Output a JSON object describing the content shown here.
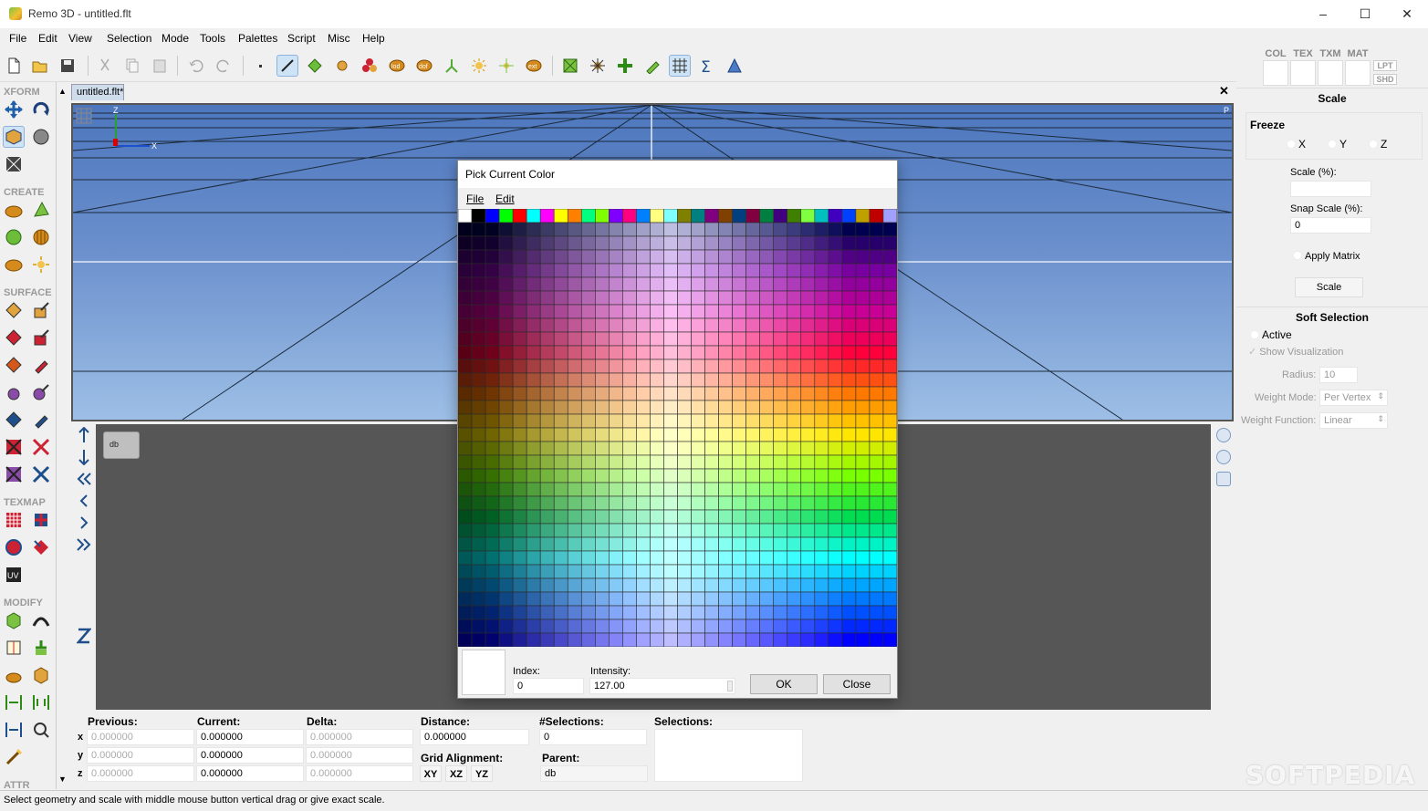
{
  "window": {
    "title": "Remo 3D - untitled.flt",
    "minimize": "–",
    "maximize": "☐",
    "close": "✕"
  },
  "menubar": [
    "File",
    "Edit",
    "View",
    "Selection",
    "Mode",
    "Tools",
    "Palettes",
    "Script",
    "Misc",
    "Help"
  ],
  "toolbar_icons": [
    "new-file-icon",
    "open-folder-icon",
    "save-icon",
    "cut-icon",
    "copy-icon",
    "paste-icon",
    "undo-icon",
    "redo-icon",
    "vertex-mode-icon",
    "edge-mode-icon",
    "face-mode-icon",
    "object-mode-icon",
    "group-mode-icon",
    "lod-icon",
    "dof-icon",
    "switch-icon",
    "light-icon",
    "light-point-icon",
    "external-ref-icon",
    "bounding-box-icon",
    "sparkle-icon",
    "move-node-icon",
    "edit-node-icon",
    "grid-icon",
    "sigma-icon",
    "triangle-icon"
  ],
  "left_sections": {
    "xform": "XFORM",
    "create": "CREATE",
    "surface": "SURFACE",
    "texmap": "TEXMAP",
    "modify": "MODIFY",
    "attr": "ATTR"
  },
  "document": {
    "tab": "untitled.flt*",
    "close": "✕"
  },
  "viewport": {
    "axis_z": "Z",
    "axis_x": "X",
    "corner": "P"
  },
  "tree": {
    "root": "db"
  },
  "bottom": {
    "previous_label": "Previous:",
    "current_label": "Current:",
    "delta_label": "Delta:",
    "distance_label": "Distance:",
    "selections_count_label": "#Selections:",
    "selections_label": "Selections:",
    "axes": [
      "x",
      "y",
      "z"
    ],
    "previous": [
      "0.000000",
      "0.000000",
      "0.000000"
    ],
    "current": [
      "0.000000",
      "0.000000",
      "0.000000"
    ],
    "delta": [
      "0.000000",
      "0.000000",
      "0.000000"
    ],
    "distance": "0.000000",
    "selections_count": "0",
    "grid_alignment_label": "Grid Alignment:",
    "grid_buttons": [
      "XY",
      "XZ",
      "YZ"
    ],
    "parent_label": "Parent:",
    "parent": "db"
  },
  "status": "Select geometry and scale with middle mouse button vertical drag or give exact scale.",
  "watermark": "SOFTPEDIA",
  "right_panel": {
    "tabs": [
      "COL",
      "TEX",
      "TXM",
      "MAT"
    ],
    "small_tabs": [
      "LPT",
      "SHD"
    ],
    "scale_title": "Scale",
    "freeze_label": "Freeze",
    "freeze_axes": [
      "X",
      "Y",
      "Z"
    ],
    "scale_pct_label": "Scale (%):",
    "scale_pct_value": "",
    "snap_label": "Snap Scale (%):",
    "snap_value": "0",
    "apply_matrix": "Apply Matrix",
    "scale_button": "Scale",
    "soft_title": "Soft Selection",
    "active": "Active",
    "show_vis": "Show Visualization",
    "radius_label": "Radius:",
    "radius_value": "10",
    "weight_mode_label": "Weight Mode:",
    "weight_mode_value": "Per Vertex",
    "weight_fn_label": "Weight Function:",
    "weight_fn_value": "Linear"
  },
  "dialog": {
    "title": "Pick Current Color",
    "menu": [
      "File",
      "Edit"
    ],
    "index_label": "Index:",
    "index_value": "0",
    "intensity_label": "Intensity:",
    "intensity_value": "127.00",
    "ok": "OK",
    "close": "Close",
    "current_color": "#ffffff",
    "palette_top_row": [
      "#ffffff",
      "#000000",
      "#0000ff",
      "#00ff00",
      "#ff0000",
      "#00ffff",
      "#ff00ff",
      "#ffff00",
      "#ff8000",
      "#00ff80",
      "#80ff00",
      "#8000ff",
      "#ff0080",
      "#0080ff",
      "#ffff80",
      "#80ffff",
      "#808000",
      "#008080",
      "#800080",
      "#804000",
      "#004080",
      "#800040",
      "#008040",
      "#400080",
      "#408000",
      "#80ff40",
      "#00c0c0",
      "#4000c0",
      "#0040ff",
      "#c0a000",
      "#c00000",
      "#a0a0ff"
    ],
    "palette_columns": [
      "#0000ff",
      "#2000ff",
      "#4000ff",
      "#6000ff",
      "#8000ff",
      "#a000ff",
      "#c000ff",
      "#e000ff",
      "#ff00ff",
      "#ff00c0",
      "#ff40ff",
      "#ff80ff",
      "#c0a0ff",
      "#e0c0ff",
      "#ffffff",
      "#c0c0c0",
      "#c0a0ff",
      "#ff40c0",
      "#ff20a0",
      "#ff0080",
      "#c000ff",
      "#a000ff",
      "#8000ff",
      "#6000ff",
      "#4000ff",
      "#a060ff",
      "#8040ff",
      "#6000ff",
      "#8040ff",
      "#a060ff",
      "#c060ff",
      "#a070ff"
    ]
  }
}
